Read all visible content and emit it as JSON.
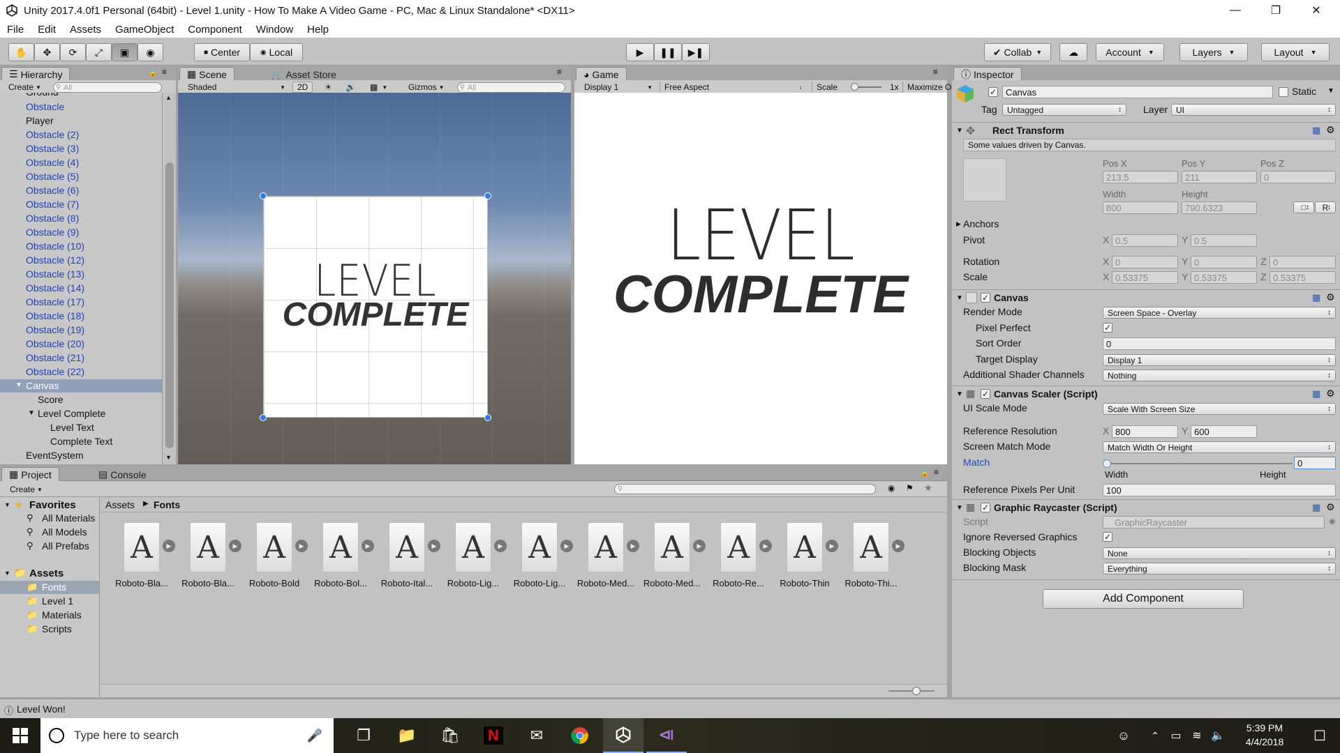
{
  "window": {
    "title": "Unity 2017.4.0f1 Personal (64bit) - Level 1.unity - How To Make A Video Game - PC, Mac & Linux Standalone* <DX11>",
    "minimize": "—",
    "restore": "❐",
    "close": "✕"
  },
  "menu": [
    "File",
    "Edit",
    "Assets",
    "GameObject",
    "Component",
    "Window",
    "Help"
  ],
  "toolbar": {
    "center": "Center",
    "local": "Local",
    "collab": "Collab",
    "account": "Account",
    "layers": "Layers",
    "layout": "Layout"
  },
  "hierarchy": {
    "tab": "Hierarchy",
    "create": "Create",
    "search": "All",
    "items": [
      {
        "label": "Ground",
        "blue": false
      },
      {
        "label": "Obstacle",
        "blue": true
      },
      {
        "label": "Player",
        "blue": false
      },
      {
        "label": "Obstacle (2)",
        "blue": true
      },
      {
        "label": "Obstacle (3)",
        "blue": true
      },
      {
        "label": "Obstacle (4)",
        "blue": true
      },
      {
        "label": "Obstacle (5)",
        "blue": true
      },
      {
        "label": "Obstacle (6)",
        "blue": true
      },
      {
        "label": "Obstacle (7)",
        "blue": true
      },
      {
        "label": "Obstacle (8)",
        "blue": true
      },
      {
        "label": "Obstacle (9)",
        "blue": true
      },
      {
        "label": "Obstacle (10)",
        "blue": true
      },
      {
        "label": "Obstacle (12)",
        "blue": true
      },
      {
        "label": "Obstacle (13)",
        "blue": true
      },
      {
        "label": "Obstacle (14)",
        "blue": true
      },
      {
        "label": "Obstacle (17)",
        "blue": true
      },
      {
        "label": "Obstacle (18)",
        "blue": true
      },
      {
        "label": "Obstacle (19)",
        "blue": true
      },
      {
        "label": "Obstacle (20)",
        "blue": true
      },
      {
        "label": "Obstacle (21)",
        "blue": true
      },
      {
        "label": "Obstacle (22)",
        "blue": true
      },
      {
        "label": "Canvas",
        "blue": false
      },
      {
        "label": "Score",
        "blue": false
      },
      {
        "label": "Level Complete",
        "blue": false
      },
      {
        "label": "Level Text",
        "blue": false
      },
      {
        "label": "Complete Text",
        "blue": false
      },
      {
        "label": "EventSystem",
        "blue": false
      }
    ]
  },
  "scene": {
    "tab": "Scene",
    "tab2": "Asset Store",
    "shading": "Shaded",
    "mode2d": "2D",
    "gizmos": "Gizmos",
    "search": "All",
    "level_text": "LEVEL",
    "complete_text": "COMPLETE"
  },
  "game": {
    "tab": "Game",
    "display": "Display 1",
    "aspect": "Free Aspect",
    "scale_label": "Scale",
    "scale_value": "1x",
    "maximize": "Maximize Or",
    "level_text": "LEVEL",
    "complete_text": "COMPLETE"
  },
  "inspector": {
    "tab": "Inspector",
    "object_name": "Canvas",
    "static": "Static",
    "tag_label": "Tag",
    "tag": "Untagged",
    "layer_label": "Layer",
    "layer": "UI",
    "rect_transform": {
      "title": "Rect Transform",
      "note": "Some values driven by Canvas.",
      "pos_x_label": "Pos X",
      "pos_y_label": "Pos Y",
      "pos_z_label": "Pos Z",
      "pos_x": "213.5",
      "pos_y": "211",
      "pos_z": "0",
      "width_label": "Width",
      "height_label": "Height",
      "width": "800",
      "height": "790.6323",
      "r_button": "R",
      "anchors": "Anchors",
      "pivot": "Pivot",
      "pivot_x": "0.5",
      "pivot_y": "0.5",
      "rotation": "Rotation",
      "rot_x": "0",
      "rot_y": "0",
      "rot_z": "0",
      "scale": "Scale",
      "scale_x": "0.53375",
      "scale_y": "0.53375",
      "scale_z": "0.53375",
      "x": "X",
      "y": "Y",
      "z": "Z"
    },
    "canvas": {
      "title": "Canvas",
      "render_mode_label": "Render Mode",
      "render_mode": "Screen Space - Overlay",
      "pixel_perfect": "Pixel Perfect",
      "sort_order_label": "Sort Order",
      "sort_order": "0",
      "target_display_label": "Target Display",
      "target_display": "Display 1",
      "shader_channels_label": "Additional Shader Channels",
      "shader_channels": "Nothing"
    },
    "scaler": {
      "title": "Canvas Scaler (Script)",
      "ui_scale_mode_label": "UI Scale Mode",
      "ui_scale_mode": "Scale With Screen Size",
      "ref_res_label": "Reference Resolution",
      "ref_x": "800",
      "ref_y": "600",
      "match_mode_label": "Screen Match Mode",
      "match_mode": "Match Width Or Height",
      "match_label": "Match",
      "match_value": "0",
      "width": "Width",
      "height": "Height",
      "ppu_label": "Reference Pixels Per Unit",
      "ppu": "100"
    },
    "raycaster": {
      "title": "Graphic Raycaster (Script)",
      "script_label": "Script",
      "script": "GraphicRaycaster",
      "ignore_label": "Ignore Reversed Graphics",
      "blocking_objects_label": "Blocking Objects",
      "blocking_objects": "None",
      "blocking_mask_label": "Blocking Mask",
      "blocking_mask": "Everything"
    },
    "add_component": "Add Component"
  },
  "project": {
    "tab": "Project",
    "console_tab": "Console",
    "create": "Create",
    "favorites": "Favorites",
    "fav_items": [
      "All Materials",
      "All Models",
      "All Prefabs"
    ],
    "assets": "Assets",
    "folders": [
      "Fonts",
      "Level 1",
      "Materials",
      "Scripts"
    ],
    "breadcrumb_root": "Assets",
    "breadcrumb_leaf": "Fonts",
    "font_glyph": "A",
    "files": [
      "Roboto-Bla...",
      "Roboto-Bla...",
      "Roboto-Bold",
      "Roboto-Bol...",
      "Roboto-Ital...",
      "Roboto-Lig...",
      "Roboto-Lig...",
      "Roboto-Med...",
      "Roboto-Med...",
      "Roboto-Re...",
      "Roboto-Thin",
      "Roboto-Thi..."
    ]
  },
  "status": {
    "message": "Level Won!"
  },
  "taskbar": {
    "search_placeholder": "Type here to search",
    "time": "5:39 PM",
    "date": "4/4/2018"
  }
}
